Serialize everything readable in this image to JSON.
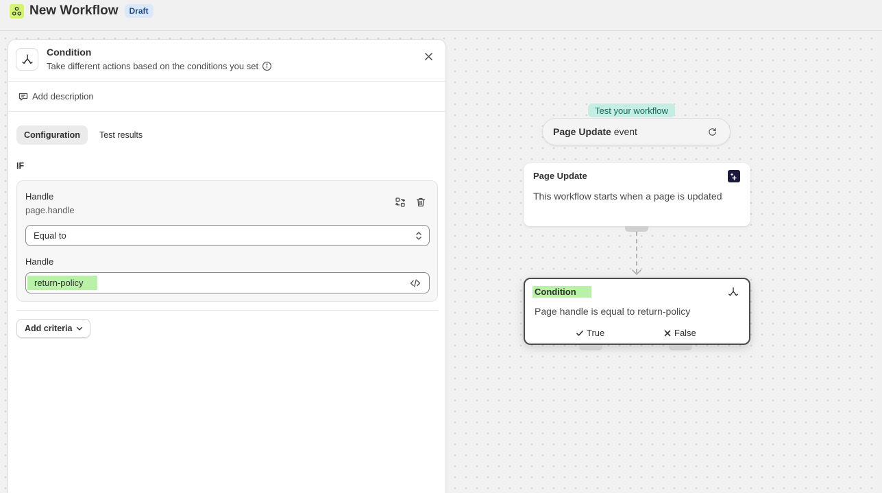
{
  "header": {
    "title": "New Workflow",
    "badge": "Draft",
    "app_icon": "workflow-icon"
  },
  "panel": {
    "title": "Condition",
    "subtitle": "Take different actions based on the conditions you set",
    "add_description": "Add description",
    "tabs": [
      {
        "label": "Configuration",
        "active": true
      },
      {
        "label": "Test results",
        "active": false
      }
    ],
    "if_label": "IF",
    "criteria": {
      "field_label": "Handle",
      "field_path": "page.handle",
      "operator": "Equal to",
      "value_label": "Handle",
      "value": "return-policy"
    },
    "add_criteria": "Add criteria"
  },
  "canvas": {
    "test_badge": "Test your workflow",
    "event_pill": {
      "bold": "Page Update",
      "text": "event"
    },
    "trigger_node": {
      "title": "Page Update",
      "body": "This workflow starts when a page is updated"
    },
    "condition_node": {
      "title": "Condition",
      "body": "Page handle is equal to return-policy",
      "true_label": "True",
      "false_label": "False"
    }
  },
  "colors": {
    "highlight": "#b9f1a8",
    "badge_bg": "#dbe8fb",
    "test_badge_bg": "#c5ede3",
    "trigger_icon_bg": "#1c1a3c"
  }
}
